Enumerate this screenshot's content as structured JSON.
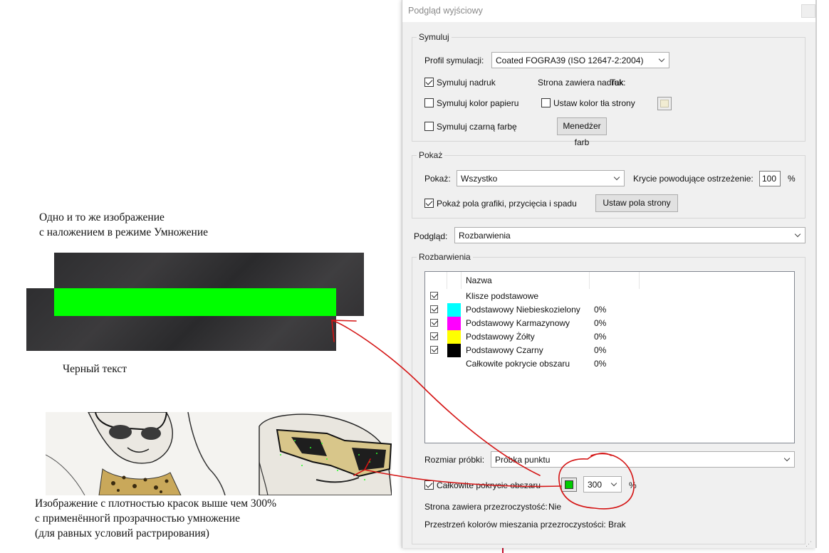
{
  "document": {
    "overlay_caption": [
      "Одно и то же изображение",
      "с наложением в режиме Умножение"
    ],
    "black_text_caption": "Черный текст",
    "bottom_caption": [
      "Изображение с плотностью красок выше чем 300%",
      "с применённогй прозрачностью умножение",
      "(для равных условий растрирования)"
    ]
  },
  "dialog": {
    "title": "Podgląd wyjściowy",
    "simulate": {
      "legend": "Symuluj",
      "profile_label": "Profil symulacji:",
      "profile_value": "Coated FOGRA39 (ISO 12647-2:2004)",
      "overprint_label": "Symuluj nadruk",
      "overprint_checked": true,
      "page_overprint_label": "Strona zawiera nadruk:",
      "page_overprint_value": "Tak",
      "paper_color_label": "Symuluj kolor papieru",
      "paper_color_checked": false,
      "page_bg_label": "Ustaw kolor tła strony",
      "page_bg_checked": false,
      "page_bg_color": "#f1ecd2",
      "black_ink_label": "Symuluj czarną farbę",
      "black_ink_checked": false,
      "color_manager_button": "Menedżer farb"
    },
    "show": {
      "legend": "Pokaż",
      "show_label": "Pokaż:",
      "show_value": "Wszystko",
      "warning_label": "Krycie powodujące ostrzeżenie:",
      "warning_value": "100",
      "warning_unit": "%",
      "boxes_label": "Pokaż pola grafiki, przycięcia i spadu",
      "boxes_checked": true,
      "page_boxes_button": "Ustaw pola strony"
    },
    "preview": {
      "label": "Podgląd:",
      "value": "Rozbarwienia"
    },
    "separations": {
      "legend": "Rozbarwienia",
      "name_header": "Nazwa",
      "rows": [
        {
          "checked": true,
          "color": "",
          "name": "Klisze podstawowe",
          "pct": ""
        },
        {
          "checked": true,
          "color": "#00ffff",
          "name": "Podstawowy Niebieskozielony",
          "pct": "0%"
        },
        {
          "checked": true,
          "color": "#ff00ff",
          "name": "Podstawowy Karmazynowy",
          "pct": "0%"
        },
        {
          "checked": true,
          "color": "#ffff00",
          "name": "Podstawowy Żółty",
          "pct": "0%"
        },
        {
          "checked": true,
          "color": "#000000",
          "name": "Podstawowy Czarny",
          "pct": "0%"
        },
        {
          "checked": false,
          "color": "",
          "name": "Całkowite pokrycie obszaru",
          "pct": "0%"
        }
      ],
      "sample_label": "Rozmiar próbki:",
      "sample_value": "Próbka punktu",
      "total_coverage_label": "Całkowite pokrycie obszaru",
      "total_coverage_checked": true,
      "coverage_color": "#00cc00",
      "coverage_value": "300",
      "coverage_unit": "%",
      "transparency_label": "Strona zawiera przezroczystość:",
      "transparency_value": "Nie",
      "blend_space_label": "Przestrzeń kolorów mieszania przezroczystości:",
      "blend_space_value": "Brak"
    }
  }
}
